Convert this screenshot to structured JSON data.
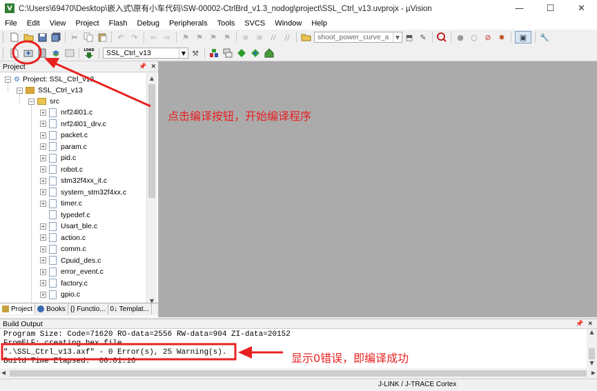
{
  "window": {
    "title": "C:\\Users\\69470\\Desktop\\嵌入式\\原有小车代码\\SW-00002-CtrlBrd_v1.3_nodog\\project\\SSL_Ctrl_v13.uvprojx - µVision",
    "app_icon_letter": "V",
    "controls": {
      "minimize": "—",
      "maximize": "☐",
      "close": "✕"
    }
  },
  "menu": [
    "File",
    "Edit",
    "View",
    "Project",
    "Flash",
    "Debug",
    "Peripherals",
    "Tools",
    "SVCS",
    "Window",
    "Help"
  ],
  "toolbar": {
    "find_combo_value": "shoot_power_curve_a",
    "target_combo_value": "SSL_Ctrl_v13",
    "load_label": "LOAD"
  },
  "project_panel": {
    "header": "Project",
    "pin": "📌",
    "close": "✕",
    "tree_root": "Project: SSL_Ctrl_v13",
    "target": "SSL_Ctrl_v13",
    "group": "src",
    "files": [
      "nrf24l01.c",
      "nrf24l01_drv.c",
      "packet.c",
      "param.c",
      "pid.c",
      "robot.c",
      "stm32f4xx_it.c",
      "system_stm32f4xx.c",
      "timer.c",
      "typedef.c",
      "Usart_ble.c",
      "action.c",
      "comm.c",
      "Cpuid_des.c",
      "error_event.c",
      "factory.c",
      "gpio.c"
    ],
    "tabs": [
      "Project",
      "Books",
      "{} Functio...",
      "0↓ Templat..."
    ]
  },
  "build_output": {
    "header": "Build Output",
    "lines": [
      "Program Size: Code=71620 RO-data=2556 RW-data=904 ZI-data=20152",
      "FromELF: creating hex file...",
      "\".\\SSL_Ctrl_v13.axf\" - 0 Error(s), 25 Warning(s).",
      "Build Time Elapsed:  00:01:16"
    ]
  },
  "status_bar": {
    "debugger": "J-LINK / J-TRACE Cortex"
  },
  "annotations": {
    "build_hint": "点击编译按钮，开始编译程序",
    "result_hint": "显示0错误，即编译成功"
  },
  "colors": {
    "annotation": "#e82020",
    "editor_bg": "#ababab"
  }
}
